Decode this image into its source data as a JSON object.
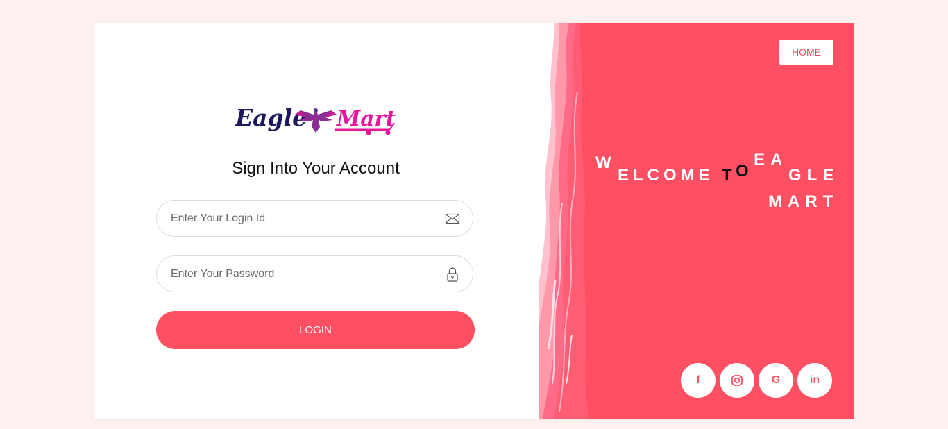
{
  "brand": {
    "logo_text_left": "Eagle",
    "logo_text_right": "Mart",
    "colors": {
      "accent": "#ff4f62",
      "background": "#fff1f0",
      "logo_navy": "#1d1760",
      "logo_pink": "#e6159b",
      "logo_purple": "#8a2e93"
    }
  },
  "login_form": {
    "title": "Sign Into Your Account",
    "login_id_placeholder": "Enter Your Login Id",
    "login_id_icon": "envelope-icon",
    "password_placeholder": "Enter Your Password",
    "password_icon": "lock-icon",
    "login_button": "LOGIN"
  },
  "right_panel": {
    "home_button": "HOME",
    "welcome_text": "WELCOME TO EAGLE MART",
    "welcome_pieces": {
      "w": "W",
      "elcome": "ELCOME",
      "t": "T",
      "o": "O",
      "ea": "EA",
      "gle": "GLE",
      "mart": "MART"
    },
    "social_links": [
      {
        "icon": "facebook-icon",
        "glyph": "f"
      },
      {
        "icon": "instagram-icon",
        "glyph": ""
      },
      {
        "icon": "google-icon",
        "glyph": "G"
      },
      {
        "icon": "linkedin-icon",
        "glyph": "in"
      }
    ]
  }
}
